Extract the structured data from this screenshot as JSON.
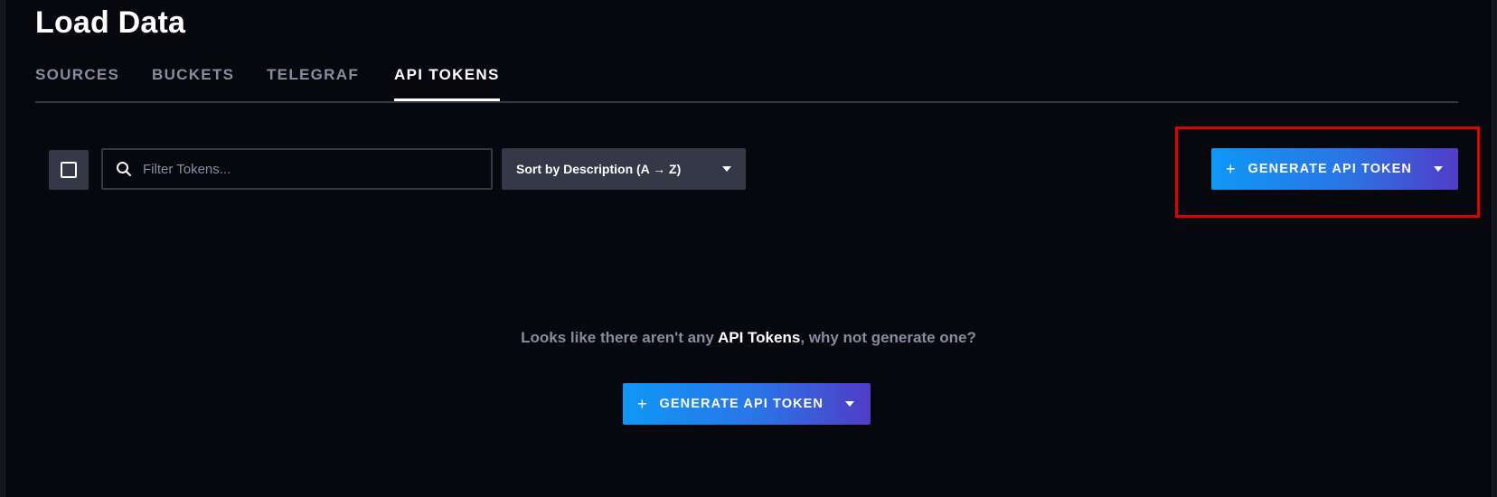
{
  "page": {
    "title": "Load Data"
  },
  "tabs": [
    {
      "label": "SOURCES"
    },
    {
      "label": "BUCKETS"
    },
    {
      "label": "TELEGRAF"
    },
    {
      "label": "API TOKENS"
    }
  ],
  "active_tab": "API TOKENS",
  "toolbar": {
    "filter_placeholder": "Filter Tokens...",
    "sort_label": "Sort by Description (A → Z)",
    "generate_label": "GENERATE API TOKEN",
    "generate_plus": "+"
  },
  "empty_state": {
    "text_before": "Looks like there aren't any ",
    "text_emphasis": "API Tokens",
    "text_after": ", why not generate one?",
    "button_label": "GENERATE API TOKEN",
    "button_plus": "+"
  },
  "colors": {
    "background": "#07080d",
    "surface": "#353947",
    "muted_text": "#878d9f",
    "gradient_start": "#0f98f7",
    "gradient_end": "#513cc6",
    "highlight_border": "#e30000"
  },
  "icons": {
    "checkbox": "checkbox-icon",
    "search": "search-icon",
    "dropdown": "caret-down-icon"
  }
}
